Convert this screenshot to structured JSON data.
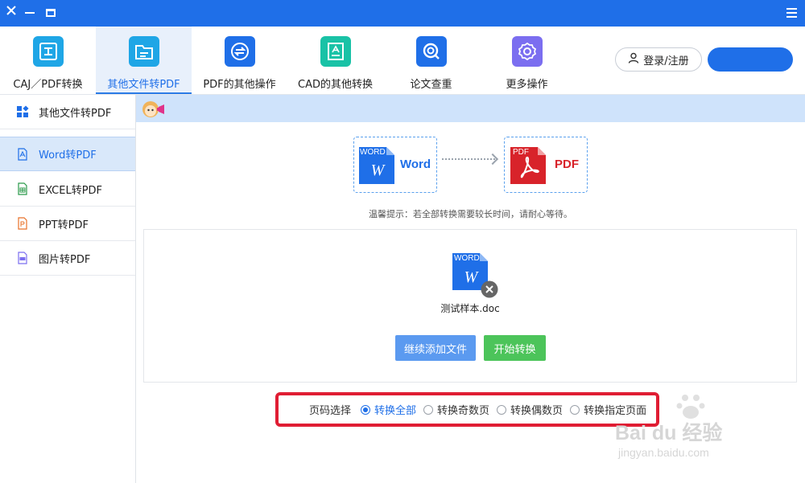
{
  "toolbar": {
    "tabs": [
      {
        "label": "CAJ／PDF转换",
        "icon": "caj-pdf-icon",
        "color": "#1fa6e6"
      },
      {
        "label": "其他文件转PDF",
        "icon": "folder-file-icon",
        "color": "#1fa6e6"
      },
      {
        "label": "PDF的其他操作",
        "icon": "swap-arrows-icon",
        "color": "#1f6fe8"
      },
      {
        "label": "CAD的其他转换",
        "icon": "cad-drawing-icon",
        "color": "#19c2a6"
      },
      {
        "label": "论文查重",
        "icon": "search-check-icon",
        "color": "#1f6fe8"
      },
      {
        "label": "更多操作",
        "icon": "gear-icon",
        "color": "#7b6ef0"
      }
    ],
    "login_label": "登录/注册",
    "active_index": 1
  },
  "sidebar": {
    "items": [
      {
        "label": "其他文件转PDF",
        "icon": "grid-apps-icon"
      },
      {
        "label": "Word转PDF",
        "icon": "pdf-file-icon"
      },
      {
        "label": "EXCEL转PDF",
        "icon": "excel-file-icon"
      },
      {
        "label": "PPT转PDF",
        "icon": "ppt-file-icon"
      },
      {
        "label": "图片转PDF",
        "icon": "jpg-file-icon"
      }
    ],
    "active_index": 1
  },
  "conversion": {
    "from_badge": "WORD",
    "from_letter": "W",
    "from_label": "Word",
    "to_badge": "PDF",
    "to_label": "PDF",
    "hint": "温馨提示：若全部转换需要较长时间，请耐心等待。"
  },
  "file": {
    "badge": "WORD",
    "letter": "W",
    "name": "测试样本.doc"
  },
  "actions": {
    "add_label": "继续添加文件",
    "start_label": "开始转换"
  },
  "page_select": {
    "label": "页码选择",
    "options": [
      "转换全部",
      "转换奇数页",
      "转换偶数页",
      "转换指定页面"
    ],
    "selected_index": 0
  },
  "watermark": {
    "brand": "Bai du 经验",
    "url": "jingyan.baidu.com"
  },
  "colors": {
    "accent": "#1f6fe8",
    "highlight_box": "#e01d33",
    "start_green": "#4cc45a",
    "pdf_red": "#d8232a"
  }
}
